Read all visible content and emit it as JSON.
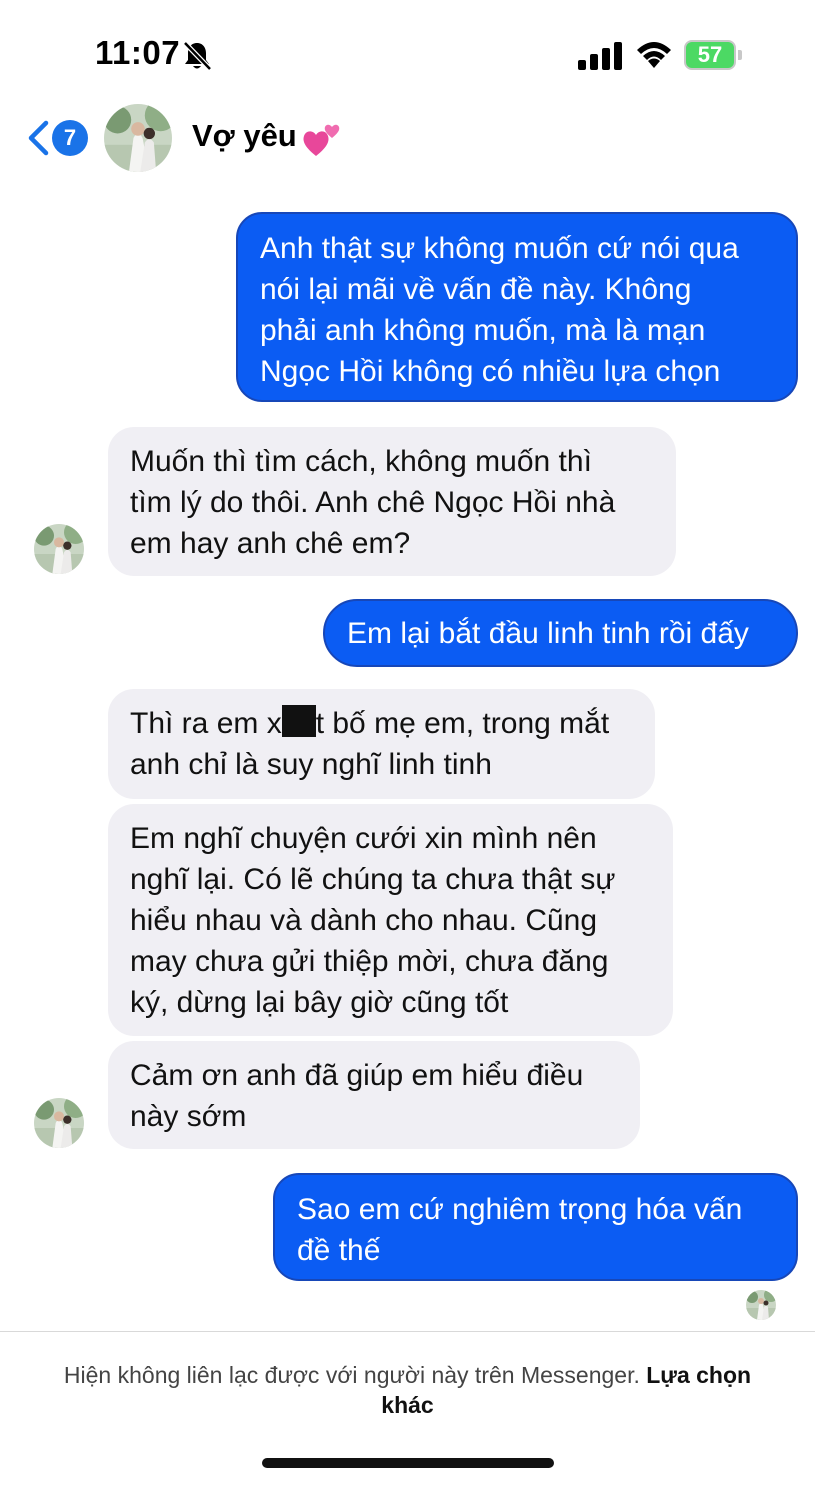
{
  "status_bar": {
    "time": "11:07",
    "battery": "57"
  },
  "header": {
    "back_badge": "7",
    "contact_name": "Vợ yêu"
  },
  "messages": [
    {
      "direction": "outgoing",
      "text": "Anh thật sự không muốn cứ nói qua\nnói lại mãi về vấn đề này. Không\nphải anh không muốn, mà là mạn\nNgọc Hồi không có nhiều lựa chọn"
    },
    {
      "direction": "incoming",
      "text": "Muốn thì tìm cách, không muốn thì\ntìm lý do thôi. Anh chê Ngọc Hồi nhà\nem hay anh chê em?"
    },
    {
      "direction": "outgoing",
      "text": "Em lại bắt đầu linh tinh rồi đấy"
    },
    {
      "direction": "incoming",
      "text_before": "Thì ra em x",
      "text_after": "t bố mẹ em, trong mắt",
      "text_line2": "anh chỉ là suy nghĩ linh tinh"
    },
    {
      "direction": "incoming",
      "text": "Em nghĩ chuyện cưới xin mình nên\nnghĩ lại. Có lẽ chúng ta chưa thật sự\nhiểu nhau và dành cho nhau. Cũng\nmay chưa gửi thiệp mời, chưa đăng\nký, dừng lại bây giờ cũng tốt"
    },
    {
      "direction": "incoming",
      "text": "Cảm ơn anh đã giúp em hiểu điều\nnày sớm"
    },
    {
      "direction": "outgoing",
      "text": "Sao em cứ nghiêm trọng hóa vấn\nđề thế"
    }
  ],
  "footer": {
    "notice": "Hiện không liên lạc được với người này trên Messenger.",
    "link": "Lựa chọn khác"
  },
  "colors": {
    "outgoing_bubble": "#0b5cf3",
    "incoming_bubble": "#f0eff4",
    "accent": "#1a73e8",
    "battery": "#4cd964"
  },
  "icons": [
    "bell-slash-icon",
    "signal-icon",
    "wifi-icon",
    "battery-icon",
    "chevron-left-icon",
    "two-hearts-icon"
  ]
}
